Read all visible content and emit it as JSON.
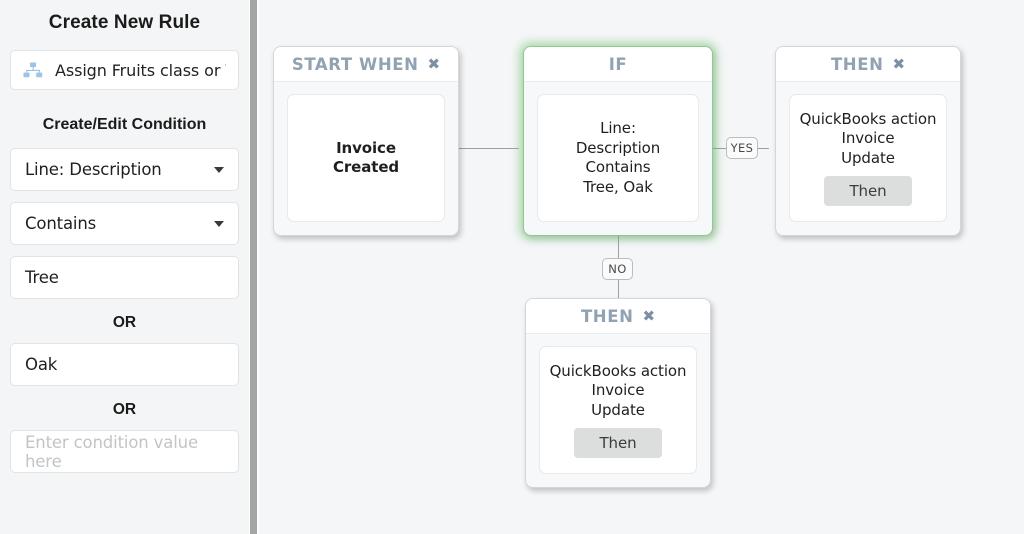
{
  "sidebar": {
    "panel_title": "Create New Rule",
    "rule_chip": {
      "icon": "hierarchy-icon",
      "label": "Assign Fruits class or Ve",
      "icon_color": "#9dc3e6"
    },
    "section_title": "Create/Edit Condition",
    "field_attribute": {
      "value": "Line: Description",
      "icon": "chevron-down-icon"
    },
    "field_operator": {
      "value": "Contains",
      "icon": "chevron-down-icon"
    },
    "value_1": "Tree",
    "or_label_1": "OR",
    "value_2": "Oak",
    "or_label_2": "OR",
    "value_3": "",
    "value_3_placeholder": "Enter condition value here"
  },
  "canvas": {
    "background": "#f5f6f8",
    "connector_color": "#9aa0a6",
    "highlight_color": "#8ec98e",
    "nodes": [
      {
        "id": "start-when",
        "title": "START WHEN",
        "close_icon": "✖",
        "has_close": true,
        "highlight": false,
        "lines": [
          "Invoice",
          "Created"
        ],
        "bold_lines": true,
        "button": null
      },
      {
        "id": "if",
        "title": "IF",
        "close_icon": "",
        "has_close": false,
        "highlight": true,
        "lines": [
          "Line:",
          "Description",
          "Contains",
          "Tree, Oak"
        ],
        "bold_lines": false,
        "button": null
      },
      {
        "id": "then-yes",
        "title": "THEN",
        "close_icon": "✖",
        "has_close": true,
        "highlight": false,
        "lines": [
          "QuickBooks action",
          "Invoice",
          "Update"
        ],
        "bold_lines": false,
        "button": "Then"
      },
      {
        "id": "then-no",
        "title": "THEN",
        "close_icon": "✖",
        "has_close": true,
        "highlight": false,
        "lines": [
          "QuickBooks action",
          "Invoice",
          "Update"
        ],
        "bold_lines": false,
        "button": "Then"
      }
    ],
    "labels": {
      "yes": "YES",
      "no": "NO"
    }
  }
}
